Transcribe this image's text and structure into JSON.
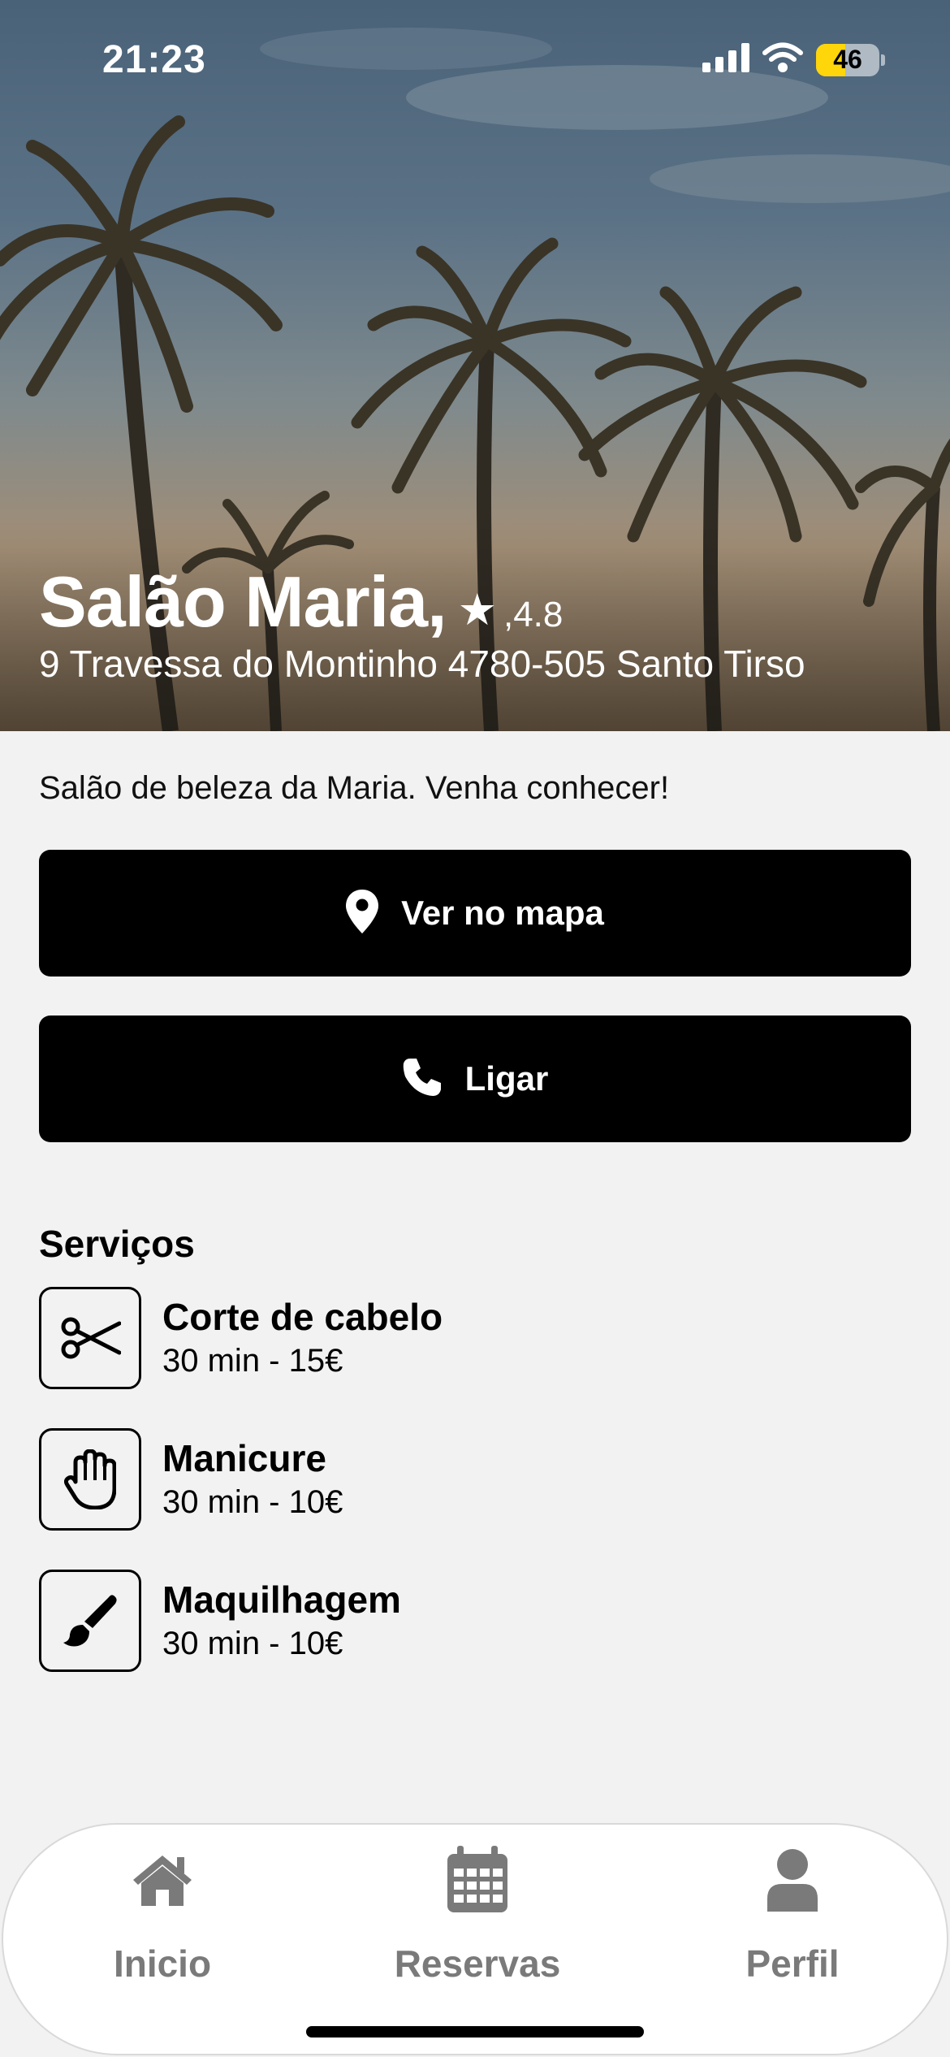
{
  "status_bar": {
    "time": "21:23",
    "battery_level": "46",
    "battery_percent": 46,
    "icons": [
      "signal-icon",
      "wifi-icon",
      "battery-icon"
    ]
  },
  "hero": {
    "salon_name": "Salão Maria,",
    "rating_value": ",4.8",
    "address": "9 Travessa do Montinho 4780-505 Santo Tirso"
  },
  "description": "Salão de beleza da Maria. Venha conhecer!",
  "actions": {
    "map_label": "Ver no mapa",
    "call_label": "Ligar"
  },
  "services": {
    "title": "Serviços",
    "items": [
      {
        "name": "Corte de cabelo",
        "meta": "30 min - 15€",
        "icon": "scissors-icon"
      },
      {
        "name": "Manicure",
        "meta": "30 min - 10€",
        "icon": "hand-icon"
      },
      {
        "name": "Maquilhagem",
        "meta": "30 min - 10€",
        "icon": "brush-icon"
      }
    ]
  },
  "tab_bar": {
    "items": [
      {
        "label": "Inicio",
        "icon": "home-icon"
      },
      {
        "label": "Reservas",
        "icon": "calendar-icon"
      },
      {
        "label": "Perfil",
        "icon": "user-icon"
      }
    ]
  },
  "colors": {
    "background": "#f2f2f2",
    "button": "#000000",
    "tab_inactive": "#7a7a7a",
    "battery_accent": "#ffd60a"
  }
}
